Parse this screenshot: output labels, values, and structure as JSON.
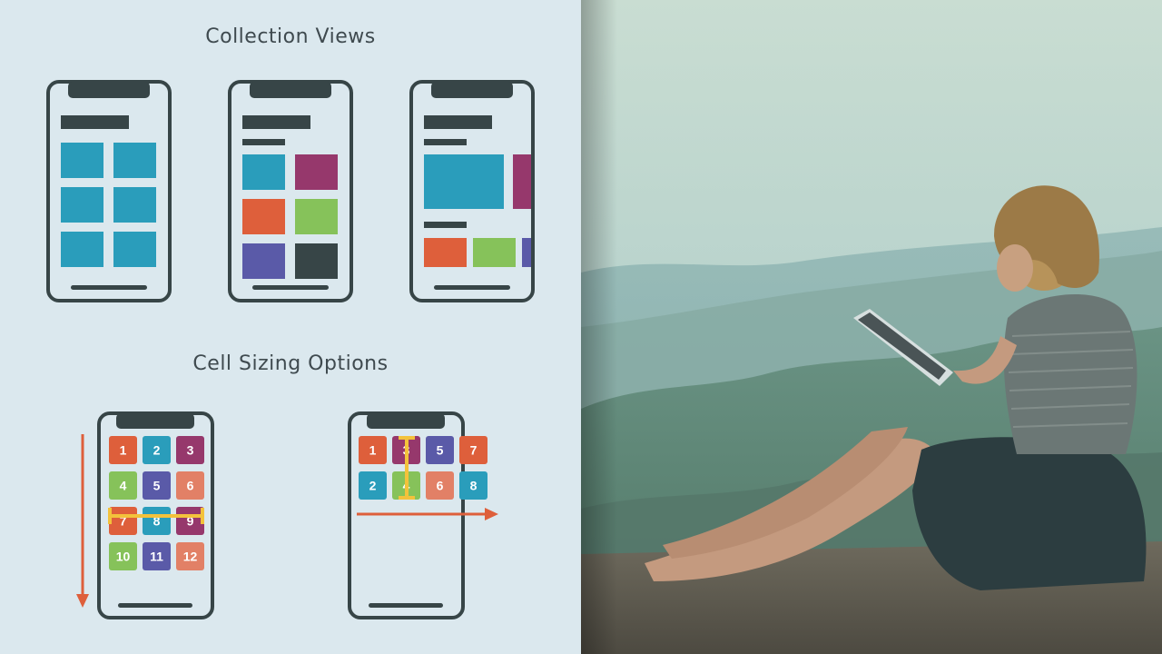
{
  "slide": {
    "section1_title": "Collection Views",
    "section2_title": "Cell Sizing Options"
  },
  "colors": {
    "background": "#dbe8ee",
    "phone_outline": "#374547",
    "teal": "#2a9dbb",
    "magenta": "#96386c",
    "orange": "#de5f3b",
    "green": "#86c25a",
    "purple": "#5a5aa8",
    "dark": "#374547",
    "salmon": "#e28066",
    "yellow_marker": "#f3c23b",
    "arrow": "#de5f3b"
  },
  "vertical_grid_cells": [
    "1",
    "2",
    "3",
    "4",
    "5",
    "6",
    "7",
    "8",
    "9",
    "10",
    "11",
    "12"
  ],
  "horizontal_grid_cells": [
    "1",
    "3",
    "5",
    "7",
    "2",
    "4",
    "6",
    "8"
  ],
  "photo": {
    "description_icon": "person-with-tablet-on-mountain-icon"
  }
}
